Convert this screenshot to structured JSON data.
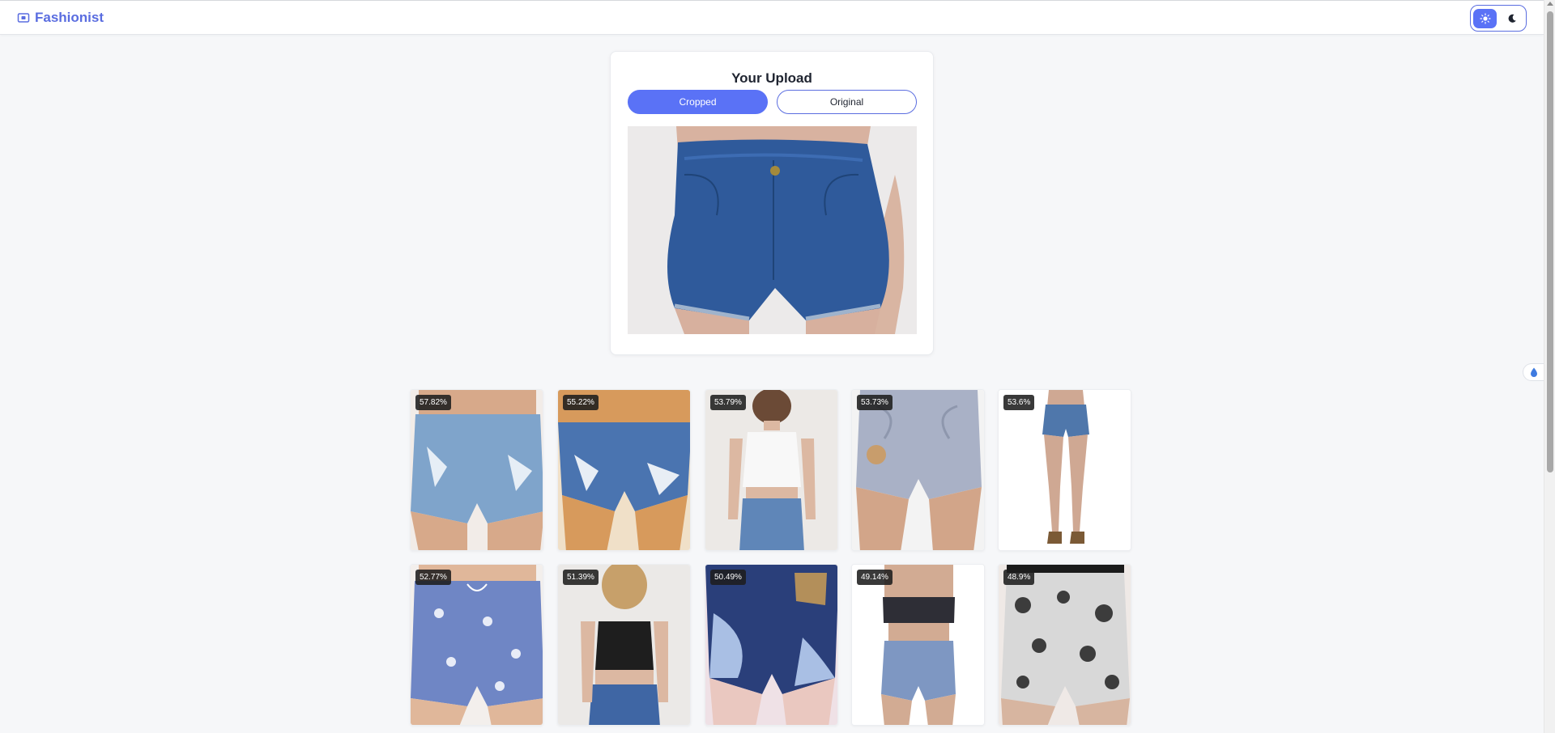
{
  "app": {
    "name": "Fashionist"
  },
  "theme": {
    "light_icon": "sun-icon",
    "dark_icon": "moon-icon",
    "active": "light"
  },
  "upload": {
    "title": "Your Upload",
    "tabs": [
      {
        "label": "Cropped",
        "active": true
      },
      {
        "label": "Original",
        "active": false
      }
    ],
    "image_subject": "denim-shorts"
  },
  "results": [
    {
      "score": "57.82%",
      "item": "ripped-denim-shorts"
    },
    {
      "score": "55.22%",
      "item": "distressed-denim-shorts"
    },
    {
      "score": "53.79%",
      "item": "white-halter-top-and-denim-shorts"
    },
    {
      "score": "53.73%",
      "item": "acid-wash-high-waist-shorts"
    },
    {
      "score": "53.6%",
      "item": "denim-shorts-full-length"
    },
    {
      "score": "52.77%",
      "item": "printed-swim-shorts"
    },
    {
      "score": "51.39%",
      "item": "black-cami-and-denim-shorts"
    },
    {
      "score": "50.49%",
      "item": "bleached-studded-denim-shorts"
    },
    {
      "score": "49.14%",
      "item": "bandana-bandeau-and-acid-shorts"
    },
    {
      "score": "48.9%",
      "item": "floral-print-shorts"
    }
  ],
  "colors": {
    "accent": "#5a72f6",
    "brand": "#5a6de0",
    "page_bg": "#f6f7f9"
  }
}
